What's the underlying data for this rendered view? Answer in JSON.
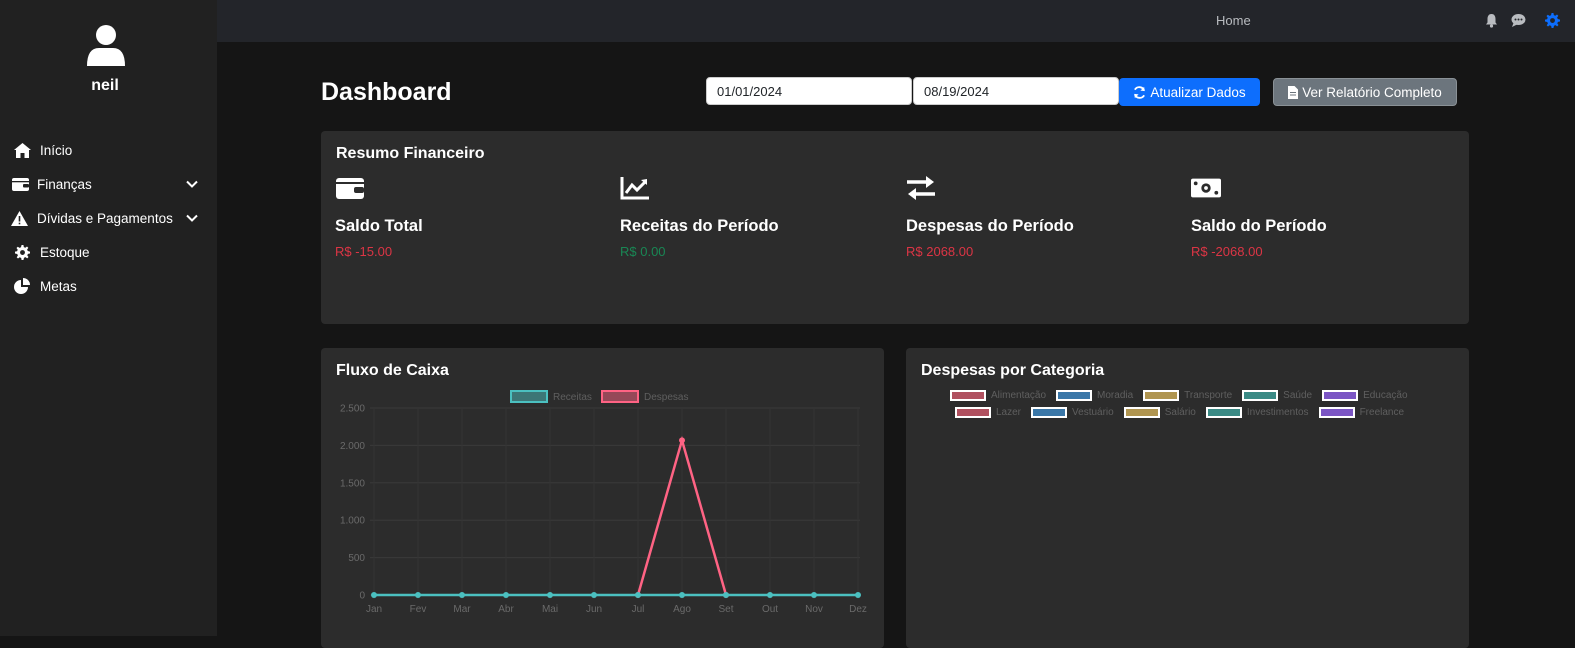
{
  "sidebar": {
    "username": "neil",
    "items": [
      {
        "label": "Início",
        "icon": "home-icon"
      },
      {
        "label": "Finanças",
        "icon": "wallet-icon"
      },
      {
        "label": "Dívidas e Pagamentos",
        "icon": "warning-icon"
      },
      {
        "label": "Estoque",
        "icon": "gear-icon"
      },
      {
        "label": "Metas",
        "icon": "pie-chart-icon"
      }
    ]
  },
  "topbar": {
    "home_label": "Home"
  },
  "header": {
    "title": "Dashboard",
    "date_start": "01/01/2024",
    "date_end": "08/19/2024",
    "refresh_button": "Atualizar Dados",
    "report_button": "Ver Relatório Completo"
  },
  "summary": {
    "title": "Resumo Financeiro",
    "stats": [
      {
        "label": "Saldo Total",
        "value": "R$ -15.00",
        "icon": "wallet-icon",
        "color": "#dc3545"
      },
      {
        "label": "Receitas do Período",
        "value": "R$ 0.00",
        "icon": "chart-line-icon",
        "color": "#198754"
      },
      {
        "label": "Despesas do Período",
        "value": "R$ 2068.00",
        "icon": "exchange-icon",
        "color": "#dc3545"
      },
      {
        "label": "Saldo do Período",
        "value": "R$ -2068.00",
        "icon": "money-bill-icon",
        "color": "#dc3545"
      }
    ]
  },
  "cashflow": {
    "title": "Fluxo de Caixa"
  },
  "categories": {
    "title": "Despesas por Categoria",
    "legend": [
      {
        "name": "Alimentação",
        "color": "#b0505f"
      },
      {
        "name": "Moradia",
        "color": "#3a77a8"
      },
      {
        "name": "Transporte",
        "color": "#b09550"
      },
      {
        "name": "Saúde",
        "color": "#3a8a85"
      },
      {
        "name": "Educação",
        "color": "#7b55c4"
      },
      {
        "name": "Lazer",
        "color": "#b0505f"
      },
      {
        "name": "Vestuário",
        "color": "#3a77a8"
      },
      {
        "name": "Salário",
        "color": "#b09550"
      },
      {
        "name": "Investimentos",
        "color": "#3a8a85"
      },
      {
        "name": "Freelance",
        "color": "#7b55c4"
      }
    ]
  },
  "chart_data": {
    "type": "line",
    "categories": [
      "Jan",
      "Fev",
      "Mar",
      "Abr",
      "Mai",
      "Jun",
      "Jul",
      "Ago",
      "Set",
      "Out",
      "Nov",
      "Dez"
    ],
    "series": [
      {
        "name": "Receitas",
        "values": [
          0,
          0,
          0,
          0,
          0,
          0,
          0,
          0,
          0,
          0,
          0,
          0
        ],
        "color": "#4bc0c0"
      },
      {
        "name": "Despesas",
        "values": [
          null,
          null,
          null,
          null,
          null,
          null,
          0,
          2068,
          0,
          null,
          null,
          null
        ],
        "color": "#ff6384"
      }
    ],
    "yticks": [
      "0",
      "500",
      "1.000",
      "1.500",
      "2.000",
      "2.500"
    ],
    "ylim": [
      0,
      2500
    ],
    "legend_position": "top"
  }
}
